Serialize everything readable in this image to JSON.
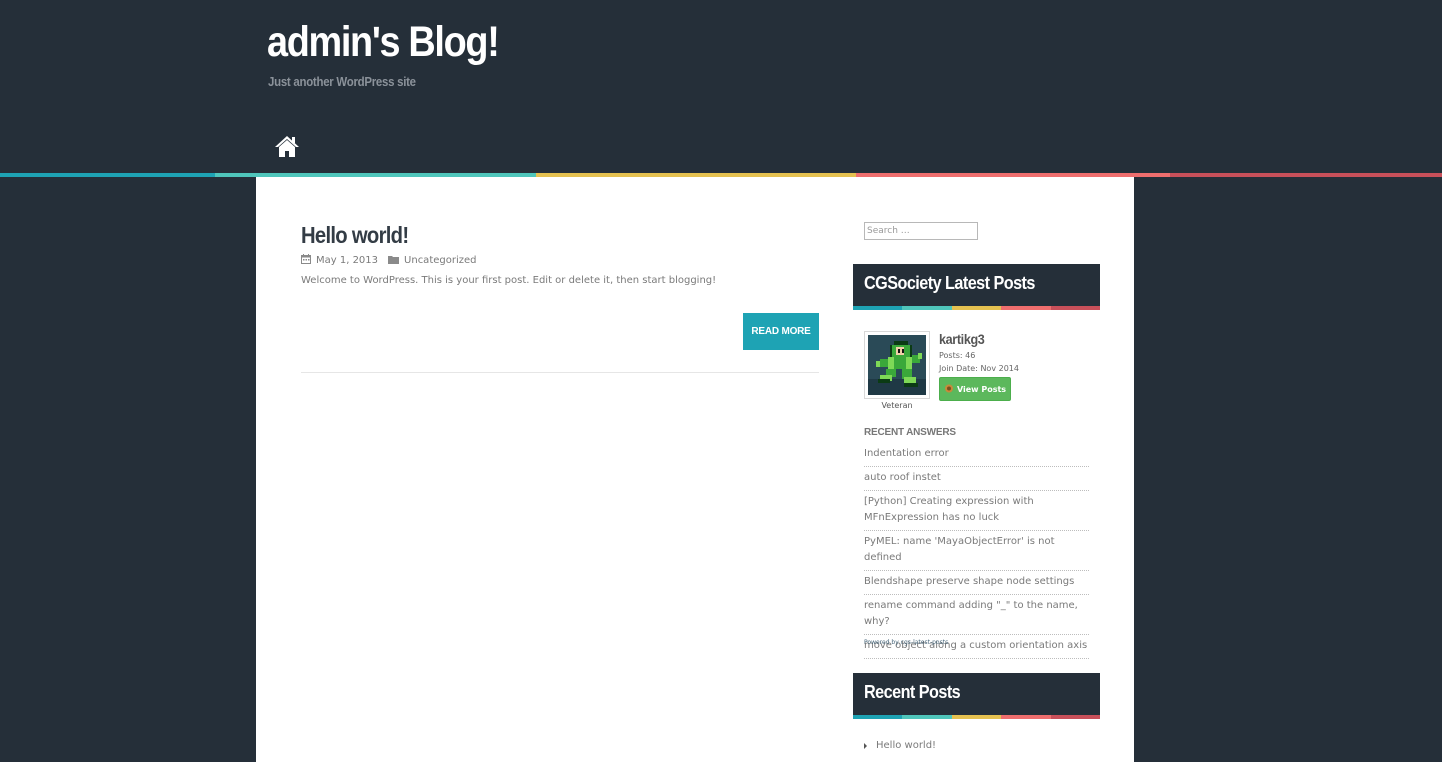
{
  "site": {
    "title": "admin's Blog!",
    "tagline": "Just another WordPress site"
  },
  "nav": {
    "home_icon": "home-icon"
  },
  "colors": {
    "background": "#252f39",
    "stripe": [
      "#1ea3b4",
      "#4fc6bb",
      "#e5c150",
      "#ef6e6e",
      "#c9505a"
    ],
    "accent": "#1ea3b4",
    "button_green": "#5cb85c"
  },
  "post": {
    "title": "Hello world!",
    "date": "May 1, 2013",
    "category": "Uncategorized",
    "excerpt": "Welcome to WordPress. This is your first post. Edit or delete it, then start blogging!",
    "read_more": "READ MORE"
  },
  "sidebar": {
    "search_placeholder": "Search …",
    "cgsociety": {
      "title": "CGSociety Latest Posts",
      "user": {
        "name": "kartikg3",
        "posts": "Posts: 46",
        "join_date": "Join Date: Nov 2014",
        "rank": "Veteran",
        "view_posts": "View Posts"
      },
      "recent_answers_label": "RECENT ANSWERS",
      "answers": [
        "Indentation error",
        "auto roof instet",
        "[Python] Creating expression with MFnExpression has no luck",
        "PyMEL: name 'MayaObjectError' is not defined",
        "Blendshape preserve shape node settings",
        "rename command adding \"_\" to the name, why?",
        "move object along a custom orientation axis"
      ],
      "powered_by": "Powered by cgs-latest-posts"
    },
    "recent_posts": {
      "title": "Recent Posts",
      "items": [
        "Hello world!"
      ]
    }
  }
}
